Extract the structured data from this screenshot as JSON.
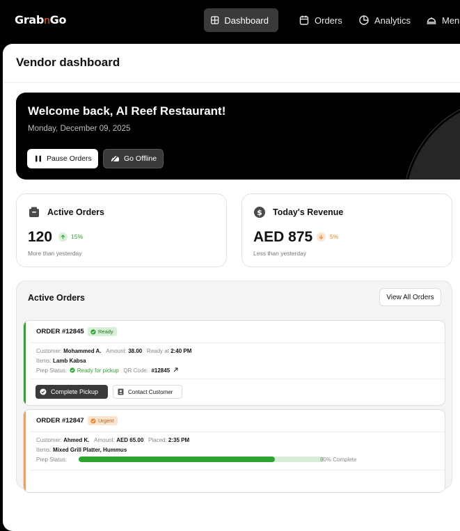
{
  "app": {
    "logo_pre": "Grab",
    "logo_accent": "n",
    "logo_post": "Go"
  },
  "nav": {
    "dashboard": "Dashboard",
    "orders": "Orders",
    "analytics": "Analytics",
    "menu": "Menu"
  },
  "page": {
    "title": "Vendor dashboard"
  },
  "hero": {
    "title": "Welcome back, Al Reef Restaurant!",
    "date": "Monday, December 09, 2025",
    "pause_label": "Pause Orders",
    "offline_label": "Go Offline"
  },
  "stats": {
    "active": {
      "label": "Active Orders",
      "value": "120",
      "change": "15%",
      "trend": "up",
      "sub": "More than yesterday",
      "color": "#2ea52e"
    },
    "revenue": {
      "label": "Today's Revenue",
      "value": "AED 875",
      "change": "5%",
      "trend": "down",
      "sub": "Less than yesterday",
      "color": "#e8862a"
    }
  },
  "orders_panel": {
    "title": "Active Orders",
    "view_all": "View All Orders"
  },
  "order1": {
    "id": "ORDER #12845",
    "status": "Ready",
    "status_color": "#2ea52e",
    "customer_label": "Customer:",
    "customer": "Mohammed A.",
    "amount_label": "Amount:",
    "amount": "38.00",
    "ready_label": "Ready at",
    "ready_time": "2:40 PM",
    "items_label": "Items:",
    "items": "Lamb Kabsa",
    "prep_label": "Prep Status:",
    "prep_status": "Ready for pickup",
    "qr_label": "QR Code:",
    "qr_code": "#12845",
    "complete_label": "Complete Pickup",
    "contact_label": "Contact Customer"
  },
  "order2": {
    "id": "ORDER #12847",
    "status": "Urgent",
    "status_color": "#e8862a",
    "customer_label": "Customer:",
    "customer": "Ahmed K.",
    "amount_label": "Amount:",
    "amount": "AED 65.00",
    "placed_label": "Placed:",
    "placed_time": "2:35 PM",
    "items_label": "Items:",
    "items": "Mixed Grill Platter, Hummus",
    "prep_label": "Prep Status:",
    "progress": 0.8,
    "progress_text": "80% Complete"
  },
  "icons": {
    "dashboard": "grid-icon",
    "orders": "calendar-icon",
    "analytics": "pie-chart-icon",
    "menu": "cloche-icon",
    "pause": "pause-icon",
    "offline": "offline-icon",
    "active_orders": "box-icon",
    "revenue": "dollar-icon"
  }
}
